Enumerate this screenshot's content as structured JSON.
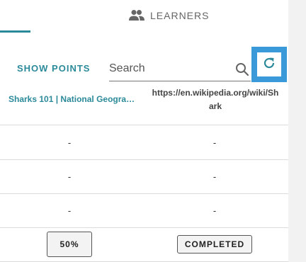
{
  "tabs": {
    "learners_label": "LEARNERS"
  },
  "toolbar": {
    "show_points_label": "SHOW POINTS",
    "search_placeholder": "Search"
  },
  "columns": [
    {
      "label": "Sharks 101 | National Geograp..."
    },
    {
      "label": "https://en.wikipedia.org/wiki/Shark"
    }
  ],
  "rows": [
    {
      "a": "-",
      "b": "-"
    },
    {
      "a": "-",
      "b": "-"
    },
    {
      "a": "-",
      "b": "-"
    },
    {
      "a": "50%",
      "b": "COMPLETED"
    }
  ],
  "colors": {
    "accent": "#2b8a99",
    "highlight": "#3a9ad9"
  },
  "icons": {
    "learners": "people-icon",
    "search": "search-icon",
    "refresh": "refresh-icon"
  }
}
